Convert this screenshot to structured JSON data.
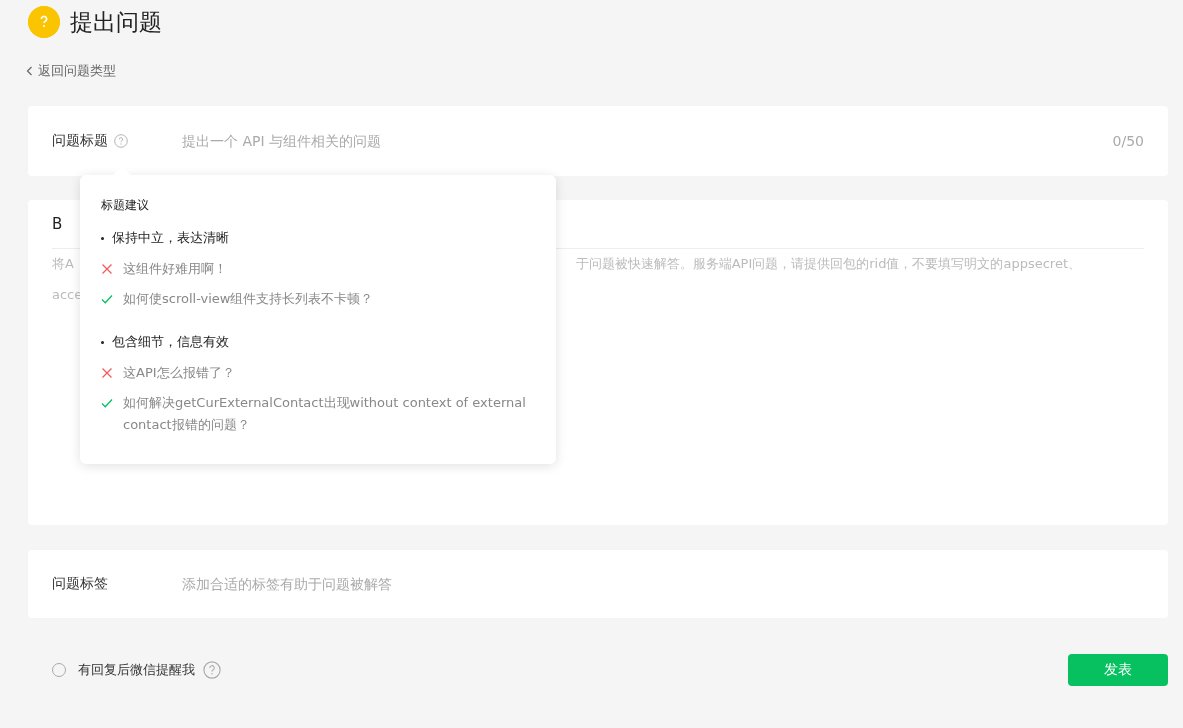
{
  "header": {
    "title": "提出问题"
  },
  "back_link": "返回问题类型",
  "title_field": {
    "label": "问题标题",
    "placeholder": "提出一个 API 与组件相关的问题",
    "counter": "0/50"
  },
  "tooltip": {
    "heading": "标题建议",
    "groups": [
      {
        "heading": "保持中立，表达清晰",
        "examples": [
          {
            "text": "这组件好难用啊！",
            "good": false
          },
          {
            "text": "如何使scroll-view组件支持长列表不卡顿？",
            "good": true
          }
        ]
      },
      {
        "heading": "包含细节，信息有效",
        "examples": [
          {
            "text": "这API怎么报错了？",
            "good": false
          },
          {
            "text": "如何解决getCurExternalContact出现without context of external contact报错的问题？",
            "good": true
          }
        ]
      }
    ]
  },
  "editor": {
    "toolbar": [
      "B"
    ],
    "lines": [
      {
        "start": "将A",
        "end": "于问题被快速解答。服务端API问题，请提供回包的rid值，不要填写明文的appsecret、"
      },
      {
        "start": "acce"
      }
    ]
  },
  "tags_field": {
    "label": "问题标签",
    "placeholder": "添加合适的标签有助于问题被解答"
  },
  "notify": {
    "label": "有回复后微信提醒我",
    "checked": false
  },
  "submit": "发表"
}
